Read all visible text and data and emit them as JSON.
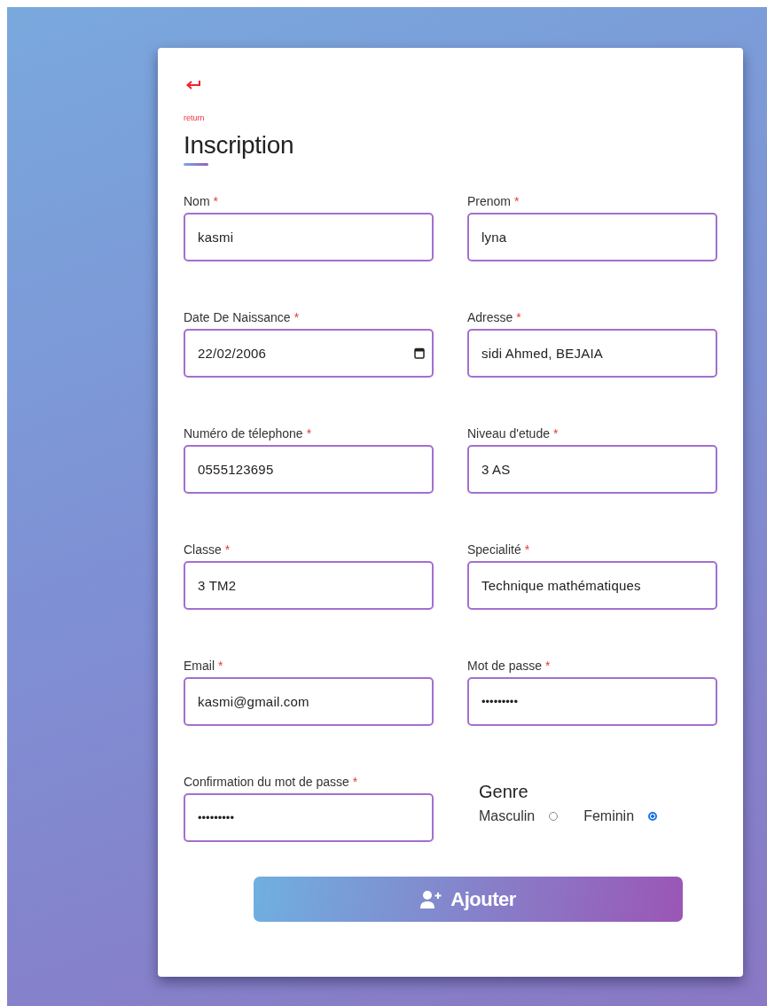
{
  "back_link": {
    "label": "return"
  },
  "title": "Inscription",
  "fields": [
    {
      "label": "Nom",
      "mark": "*",
      "kind": "text",
      "value": "kasmi"
    },
    {
      "label": "Prenom",
      "mark": "*",
      "kind": "text",
      "value": "lyna"
    },
    {
      "label": "Date De Naissance",
      "mark": "*",
      "kind": "date",
      "value": "22/02/2006"
    },
    {
      "label": "Adresse",
      "mark": "*",
      "kind": "text",
      "value": "sidi Ahmed, BEJAIA"
    },
    {
      "label": "Numéro de télephone",
      "mark": "*",
      "kind": "text",
      "value": "0555123695"
    },
    {
      "label": "Niveau d'etude",
      "mark": "*",
      "kind": "text",
      "value": "3 AS"
    },
    {
      "label": "Classe",
      "mark": "*",
      "kind": "text",
      "value": "3 TM2"
    },
    {
      "label": "Specialité",
      "mark": "*",
      "kind": "text",
      "value": "Technique mathématiques"
    },
    {
      "label": "Email",
      "mark": "*",
      "kind": "text",
      "value": "kasmi@gmail.com"
    },
    {
      "label": "Mot de passe",
      "mark": "*",
      "kind": "password",
      "value": "•••••••••"
    },
    {
      "label": "Confirmation du mot de passe",
      "mark": "*",
      "kind": "password",
      "value": "•••••••••"
    }
  ],
  "gender": {
    "label": "Genre",
    "options": [
      {
        "label": "Masculin",
        "selected": false
      },
      {
        "label": "Feminin",
        "selected": true
      }
    ]
  },
  "submit": {
    "label": "Ajouter"
  }
}
